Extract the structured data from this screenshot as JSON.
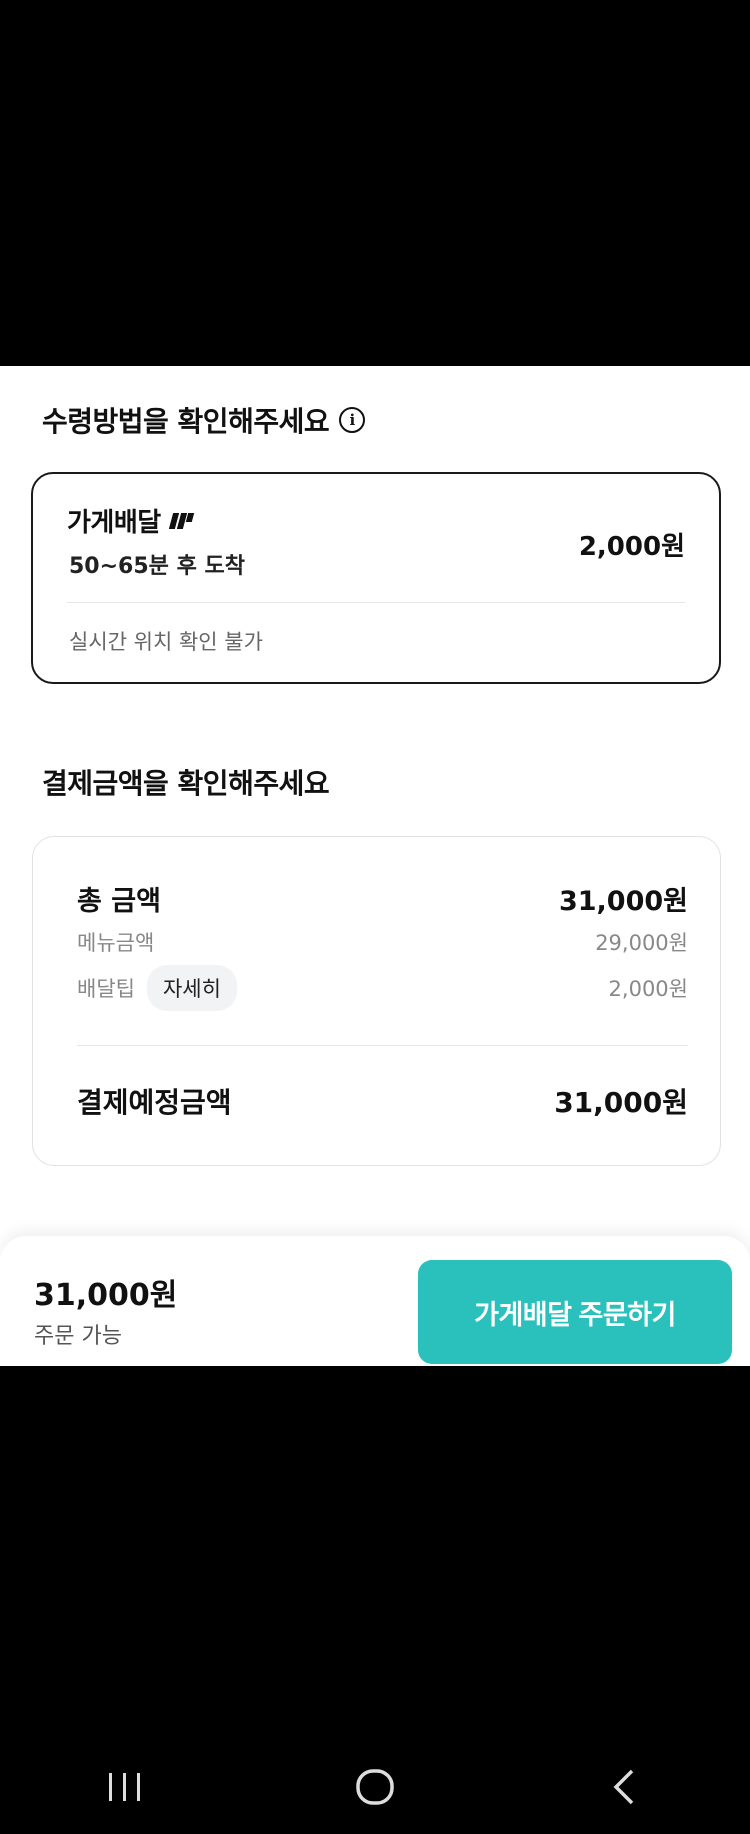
{
  "pickup_section": {
    "title": "수령방법을 확인해주세요",
    "info_icon": "info-icon",
    "delivery_option": {
      "name": "가게배달",
      "logo": "baemin-logo-icon",
      "eta": "50~65분 후 도착",
      "price": "2,000원",
      "note": "실시간 위치 확인 불가"
    }
  },
  "payment_section": {
    "title": "결제금액을 확인해주세요",
    "total_label": "총 금액",
    "total_value": "31,000원",
    "menu_label": "메뉴금액",
    "menu_value": "29,000원",
    "tip_label": "배달팁",
    "tip_detail_chip": "자세히",
    "tip_value": "2,000원",
    "final_label": "결제예정금액",
    "final_value": "31,000원"
  },
  "bottom_bar": {
    "price": "31,000원",
    "status": "주문 가능",
    "order_button": "가게배달 주문하기",
    "accent_color": "#2ac1bc"
  },
  "nav_bar": {
    "recent_icon": "recent-apps-icon",
    "home_icon": "home-icon",
    "back_icon": "back-icon"
  }
}
